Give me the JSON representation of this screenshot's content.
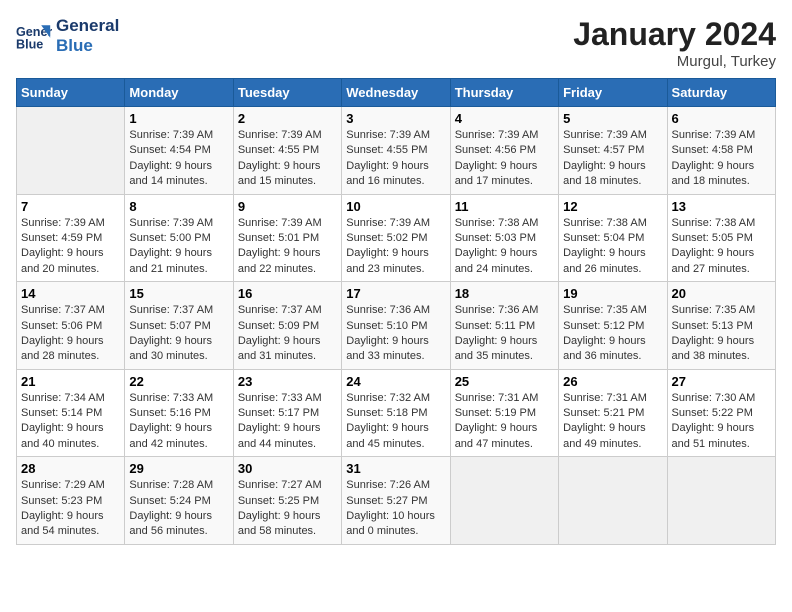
{
  "header": {
    "logo_line1": "General",
    "logo_line2": "Blue",
    "title": "January 2024",
    "subtitle": "Murgul, Turkey"
  },
  "weekdays": [
    "Sunday",
    "Monday",
    "Tuesday",
    "Wednesday",
    "Thursday",
    "Friday",
    "Saturday"
  ],
  "weeks": [
    [
      {
        "empty": true
      },
      {
        "day": 1,
        "sunrise": "7:39 AM",
        "sunset": "4:54 PM",
        "daylight": "9 hours and 14 minutes."
      },
      {
        "day": 2,
        "sunrise": "7:39 AM",
        "sunset": "4:55 PM",
        "daylight": "9 hours and 15 minutes."
      },
      {
        "day": 3,
        "sunrise": "7:39 AM",
        "sunset": "4:55 PM",
        "daylight": "9 hours and 16 minutes."
      },
      {
        "day": 4,
        "sunrise": "7:39 AM",
        "sunset": "4:56 PM",
        "daylight": "9 hours and 17 minutes."
      },
      {
        "day": 5,
        "sunrise": "7:39 AM",
        "sunset": "4:57 PM",
        "daylight": "9 hours and 18 minutes."
      },
      {
        "day": 6,
        "sunrise": "7:39 AM",
        "sunset": "4:58 PM",
        "daylight": "9 hours and 18 minutes."
      }
    ],
    [
      {
        "day": 7,
        "sunrise": "7:39 AM",
        "sunset": "4:59 PM",
        "daylight": "9 hours and 20 minutes."
      },
      {
        "day": 8,
        "sunrise": "7:39 AM",
        "sunset": "5:00 PM",
        "daylight": "9 hours and 21 minutes."
      },
      {
        "day": 9,
        "sunrise": "7:39 AM",
        "sunset": "5:01 PM",
        "daylight": "9 hours and 22 minutes."
      },
      {
        "day": 10,
        "sunrise": "7:39 AM",
        "sunset": "5:02 PM",
        "daylight": "9 hours and 23 minutes."
      },
      {
        "day": 11,
        "sunrise": "7:38 AM",
        "sunset": "5:03 PM",
        "daylight": "9 hours and 24 minutes."
      },
      {
        "day": 12,
        "sunrise": "7:38 AM",
        "sunset": "5:04 PM",
        "daylight": "9 hours and 26 minutes."
      },
      {
        "day": 13,
        "sunrise": "7:38 AM",
        "sunset": "5:05 PM",
        "daylight": "9 hours and 27 minutes."
      }
    ],
    [
      {
        "day": 14,
        "sunrise": "7:37 AM",
        "sunset": "5:06 PM",
        "daylight": "9 hours and 28 minutes."
      },
      {
        "day": 15,
        "sunrise": "7:37 AM",
        "sunset": "5:07 PM",
        "daylight": "9 hours and 30 minutes."
      },
      {
        "day": 16,
        "sunrise": "7:37 AM",
        "sunset": "5:09 PM",
        "daylight": "9 hours and 31 minutes."
      },
      {
        "day": 17,
        "sunrise": "7:36 AM",
        "sunset": "5:10 PM",
        "daylight": "9 hours and 33 minutes."
      },
      {
        "day": 18,
        "sunrise": "7:36 AM",
        "sunset": "5:11 PM",
        "daylight": "9 hours and 35 minutes."
      },
      {
        "day": 19,
        "sunrise": "7:35 AM",
        "sunset": "5:12 PM",
        "daylight": "9 hours and 36 minutes."
      },
      {
        "day": 20,
        "sunrise": "7:35 AM",
        "sunset": "5:13 PM",
        "daylight": "9 hours and 38 minutes."
      }
    ],
    [
      {
        "day": 21,
        "sunrise": "7:34 AM",
        "sunset": "5:14 PM",
        "daylight": "9 hours and 40 minutes."
      },
      {
        "day": 22,
        "sunrise": "7:33 AM",
        "sunset": "5:16 PM",
        "daylight": "9 hours and 42 minutes."
      },
      {
        "day": 23,
        "sunrise": "7:33 AM",
        "sunset": "5:17 PM",
        "daylight": "9 hours and 44 minutes."
      },
      {
        "day": 24,
        "sunrise": "7:32 AM",
        "sunset": "5:18 PM",
        "daylight": "9 hours and 45 minutes."
      },
      {
        "day": 25,
        "sunrise": "7:31 AM",
        "sunset": "5:19 PM",
        "daylight": "9 hours and 47 minutes."
      },
      {
        "day": 26,
        "sunrise": "7:31 AM",
        "sunset": "5:21 PM",
        "daylight": "9 hours and 49 minutes."
      },
      {
        "day": 27,
        "sunrise": "7:30 AM",
        "sunset": "5:22 PM",
        "daylight": "9 hours and 51 minutes."
      }
    ],
    [
      {
        "day": 28,
        "sunrise": "7:29 AM",
        "sunset": "5:23 PM",
        "daylight": "9 hours and 54 minutes."
      },
      {
        "day": 29,
        "sunrise": "7:28 AM",
        "sunset": "5:24 PM",
        "daylight": "9 hours and 56 minutes."
      },
      {
        "day": 30,
        "sunrise": "7:27 AM",
        "sunset": "5:25 PM",
        "daylight": "9 hours and 58 minutes."
      },
      {
        "day": 31,
        "sunrise": "7:26 AM",
        "sunset": "5:27 PM",
        "daylight": "10 hours and 0 minutes."
      },
      {
        "empty": true
      },
      {
        "empty": true
      },
      {
        "empty": true
      }
    ]
  ],
  "labels": {
    "sunrise": "Sunrise:",
    "sunset": "Sunset:",
    "daylight": "Daylight:"
  }
}
